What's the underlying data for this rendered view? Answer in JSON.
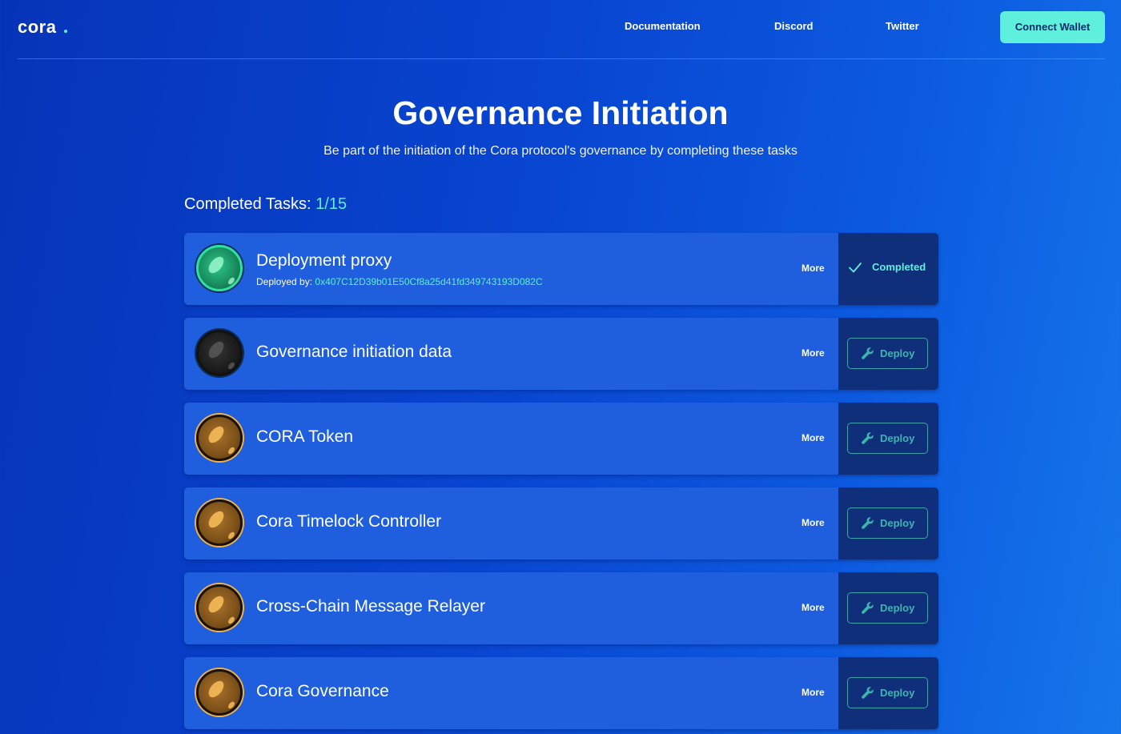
{
  "brand": {
    "logo_text": "cora"
  },
  "nav": {
    "links": [
      "Documentation",
      "Discord",
      "Twitter"
    ],
    "connect_wallet_label": "Connect Wallet"
  },
  "hero": {
    "title": "Governance Initiation",
    "subtitle": "Be part of the initiation of the Cora protocol's governance by completing these tasks"
  },
  "progress": {
    "label": "Completed Tasks:",
    "count": "1/15"
  },
  "tasks": [
    {
      "name": "Deployment proxy",
      "status": "completed",
      "status_label": "Completed",
      "deployed_by_label": "Deployed by:",
      "deployed_by_address": "0x407C12D39b01E50Cf8a25d41fd349743193D082C",
      "more_label": "More",
      "icon": "green-orb-icon"
    },
    {
      "name": "Governance initiation data",
      "status": "pending",
      "action_label": "Deploy",
      "more_label": "More",
      "icon": "black-orb-icon"
    },
    {
      "name": "CORA Token",
      "status": "pending",
      "action_label": "Deploy",
      "more_label": "More",
      "icon": "gold-orb-icon"
    },
    {
      "name": "Cora Timelock Controller",
      "status": "pending",
      "action_label": "Deploy",
      "more_label": "More",
      "icon": "gold-orb-icon"
    },
    {
      "name": "Cross-Chain Message Relayer",
      "status": "pending",
      "action_label": "Deploy",
      "more_label": "More",
      "icon": "gold-orb-icon"
    },
    {
      "name": "Cora Governance",
      "status": "pending",
      "action_label": "Deploy",
      "more_label": "More",
      "icon": "gold-orb-icon"
    }
  ],
  "colors": {
    "accent": "#5ef0dc",
    "card": "#1f5edc",
    "action_panel": "#0f2f7a",
    "deploy_border": "#3fa4a8",
    "orb_green": "#1f9e6c",
    "orb_black": "#1c1c1c",
    "orb_gold": "#8a5a1e"
  }
}
